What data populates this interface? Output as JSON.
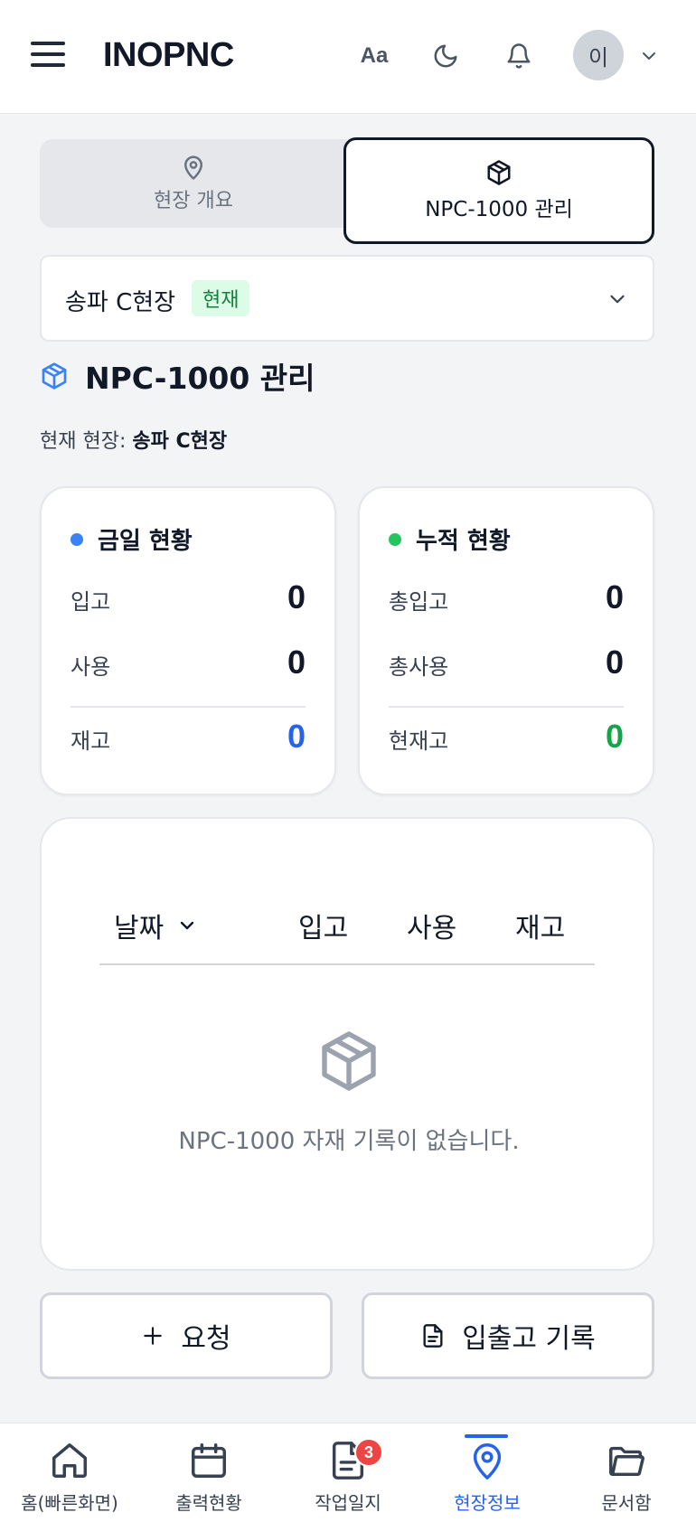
{
  "header": {
    "brand": "INOPNC",
    "font_size_label": "Aa",
    "avatar_initial": "이"
  },
  "tabs": [
    {
      "label": "현장 개요",
      "icon": "map-pin-icon",
      "active": false
    },
    {
      "label": "NPC-1000 관리",
      "icon": "package-icon",
      "active": true
    }
  ],
  "site_select": {
    "name": "송파 C현장",
    "badge": "현재"
  },
  "section": {
    "title": "NPC-1000 관리",
    "current_site_label": "현재 현장:",
    "current_site_value": "송파 C현장"
  },
  "today": {
    "title": "금일 현황",
    "dot_color": "#3b82f6",
    "rows": [
      {
        "label": "입고",
        "value": "0"
      },
      {
        "label": "사용",
        "value": "0"
      },
      {
        "label": "재고",
        "value": "0"
      }
    ],
    "stock_color": "#2563eb"
  },
  "cumulative": {
    "title": "누적 현황",
    "dot_color": "#22c55e",
    "rows": [
      {
        "label": "총입고",
        "value": "0"
      },
      {
        "label": "총사용",
        "value": "0"
      },
      {
        "label": "현재고",
        "value": "0"
      }
    ],
    "stock_color": "#16a34a"
  },
  "table": {
    "headers": {
      "date": "날짜",
      "in": "입고",
      "use": "사용",
      "stock": "재고"
    },
    "empty_message": "NPC-1000 자재 기록이 없습니다."
  },
  "actions": {
    "request": "요청",
    "records": "입출고 기록"
  },
  "bottom_nav": [
    {
      "label": "홈(빠른화면)",
      "icon": "home-icon"
    },
    {
      "label": "출력현황",
      "icon": "calendar-icon"
    },
    {
      "label": "작업일지",
      "icon": "document-icon",
      "badge": "3"
    },
    {
      "label": "현장정보",
      "icon": "map-pin-icon",
      "active": true
    },
    {
      "label": "문서함",
      "icon": "folder-icon"
    }
  ]
}
